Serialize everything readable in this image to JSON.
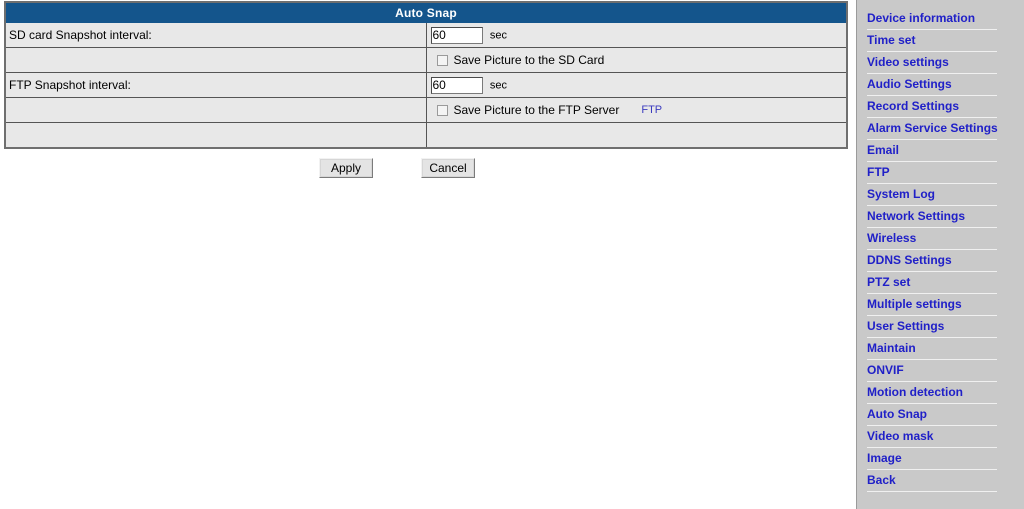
{
  "panel": {
    "title": "Auto Snap",
    "rows": [
      {
        "type": "input",
        "label": "SD card Snapshot interval:",
        "value": "60",
        "unit": "sec"
      },
      {
        "type": "checkbox",
        "label": "",
        "checkbox_label": "Save Picture to the SD Card",
        "checked": false
      },
      {
        "type": "input",
        "label": "FTP Snapshot interval:",
        "value": "60",
        "unit": "sec"
      },
      {
        "type": "checkbox",
        "label": "",
        "checkbox_label": "Save Picture to the FTP Server",
        "checked": false,
        "link_label": "FTP"
      },
      {
        "type": "empty",
        "label": "",
        "value": ""
      }
    ]
  },
  "buttons": {
    "apply_label": "Apply",
    "cancel_label": "Cancel"
  },
  "sidebar": {
    "items": [
      {
        "label": "Device information"
      },
      {
        "label": "Time set"
      },
      {
        "label": "Video settings"
      },
      {
        "label": "Audio Settings"
      },
      {
        "label": "Record Settings"
      },
      {
        "label": "Alarm Service Settings"
      },
      {
        "label": "Email"
      },
      {
        "label": "FTP"
      },
      {
        "label": "System Log"
      },
      {
        "label": "Network Settings"
      },
      {
        "label": "Wireless"
      },
      {
        "label": "DDNS Settings"
      },
      {
        "label": "PTZ set"
      },
      {
        "label": "Multiple settings"
      },
      {
        "label": "User Settings"
      },
      {
        "label": "Maintain"
      },
      {
        "label": "ONVIF"
      },
      {
        "label": "Motion detection"
      },
      {
        "label": "Auto Snap"
      },
      {
        "label": "Video mask"
      },
      {
        "label": "Image"
      },
      {
        "label": "Back"
      }
    ]
  },
  "colors": {
    "title_bar": "#14558c",
    "link": "#2020c8",
    "sidebar_bg": "#c9c9c9",
    "row_bg": "#e8e8e8"
  }
}
